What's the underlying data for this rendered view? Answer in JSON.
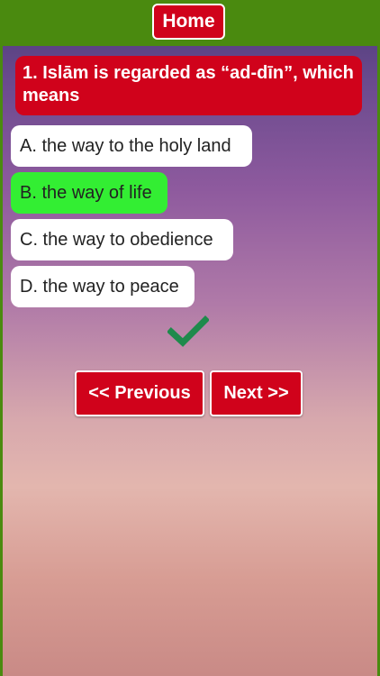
{
  "header": {
    "home_label": "Home"
  },
  "question": {
    "text": "1. Islām is regarded as “ad-dīn”, which means"
  },
  "options": [
    {
      "label": "A. the way to the holy land",
      "correct": false
    },
    {
      "label": "B. the way of life",
      "correct": true
    },
    {
      "label": "C. the way to obedience",
      "correct": false
    },
    {
      "label": "D. the way to peace",
      "correct": false
    }
  ],
  "feedback": {
    "icon": "checkmark-icon",
    "color": "#1e8a4c"
  },
  "navigation": {
    "previous_label": "<< Previous",
    "next_label": "Next >>"
  },
  "colors": {
    "top_bar": "#4a8a0f",
    "button_red": "#d0021b",
    "correct_green": "#33ee33"
  }
}
